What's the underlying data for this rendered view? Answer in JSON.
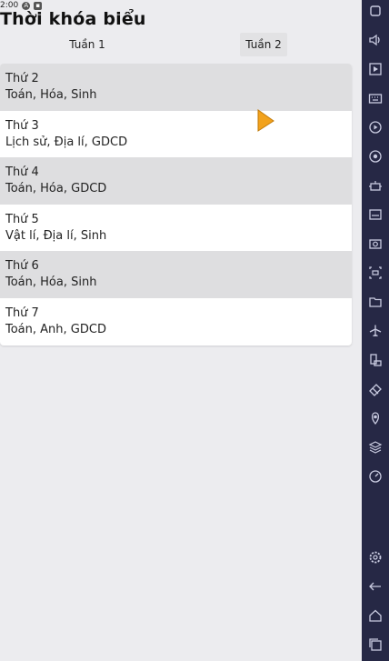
{
  "status_bar": {
    "time": "2:00"
  },
  "app": {
    "title": "Thời khóa biểu",
    "tabs": [
      {
        "label": "Tuần 1"
      },
      {
        "label": "Tuần 2"
      }
    ],
    "selected_tab": "Tuần 2",
    "schedule": [
      {
        "day": "Thứ 2",
        "subjects": "Toán, Hóa, Sinh"
      },
      {
        "day": "Thứ 3",
        "subjects": "Lịch sử, Địa lí, GDCD"
      },
      {
        "day": "Thứ 4",
        "subjects": "Toán, Hóa, GDCD"
      },
      {
        "day": "Thứ 5",
        "subjects": "Vật lí, Địa lí, Sinh"
      },
      {
        "day": "Thứ 6",
        "subjects": "Toán, Hóa, Sinh"
      },
      {
        "day": "Thứ 7",
        "subjects": "Toán, Anh, GDCD"
      }
    ]
  },
  "emulator_toolbar": {
    "icons": [
      "more-icon",
      "volume-icon",
      "shortcut-icon",
      "keyboard-icon",
      "play-icon",
      "record-icon",
      "robot-icon",
      "apk-icon",
      "screenshot-icon",
      "video-icon",
      "folder-icon",
      "airplane-icon",
      "rotate-icon",
      "erase-icon",
      "location-icon",
      "layers-icon",
      "speed-icon",
      "settings-icon",
      "back-icon",
      "home-icon",
      "recents-icon"
    ]
  },
  "colors": {
    "toolbar_bg": "#262845",
    "row_shade": "#dedee0",
    "cursor": "#f2a21c"
  }
}
